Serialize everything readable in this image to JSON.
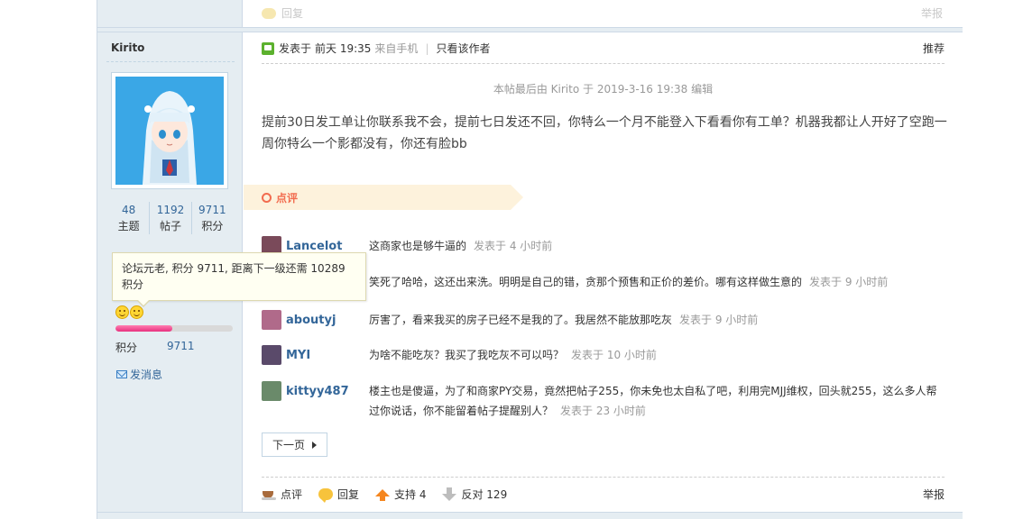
{
  "prev_post": {
    "reply_label": "回复",
    "report_label": "举报"
  },
  "author": {
    "name": "Kirito",
    "stats": [
      {
        "num": "48",
        "label": "主题"
      },
      {
        "num": "1192",
        "label": "帖子"
      },
      {
        "num": "9711",
        "label": "积分"
      }
    ],
    "tooltip": "论坛元老, 积分 9711, 距离下一级还需 10289 积分",
    "progress": 0.485,
    "score_label": "积分",
    "score_value": "9711",
    "send_message": "发消息"
  },
  "post": {
    "posted_prefix": "发表于",
    "posted_time": "前天 19:35",
    "from_mobile": "来自手机",
    "separator": "|",
    "only_author": "只看该作者",
    "recommend": "推荐",
    "edit_note": "本帖最后由 Kirito 于 2019-3-16 19:38 编辑",
    "content": "提前30日发工单让你联系我不会，提前七日发还不回，你特么一个月不能登入下看看你有工单？机器我都让人开好了空跑一周你特么一个影都没有，你还有脸bb"
  },
  "review": {
    "label": "点评",
    "comments": [
      {
        "user": "Lancelot",
        "text": "这商家也是够牛逼的",
        "time": "发表于 4 小时前",
        "avatar_color": "#7a4a5a"
      },
      {
        "user": "",
        "text": "笑死了哈哈，这还出来洗。明明是自己的错，贪那个预售和正价的差价。哪有这样做生意的",
        "time": "发表于 9 小时前",
        "avatar_color": "#888888"
      },
      {
        "user": "aboutyj",
        "text": "厉害了，看来我买的房子已经不是我的了。我居然不能放那吃灰",
        "time": "发表于 9 小时前",
        "avatar_color": "#b06a8a"
      },
      {
        "user": "MYI",
        "text": "为啥不能吃灰？我买了我吃灰不可以吗？",
        "time": "发表于 10 小时前",
        "avatar_color": "#5a4a6a"
      },
      {
        "user": "kittyy487",
        "text": "楼主也是傻逼，为了和商家PY交易，竟然把帖子255，你未免也太自私了吧，利用完MJJ维权，回头就255，这么多人帮过你说话，你不能留着帖子提醒别人？",
        "time": "发表于 23 小时前",
        "avatar_color": "#6a8a6a"
      }
    ],
    "next_page": "下一页"
  },
  "actions": {
    "review": "点评",
    "reply": "回复",
    "support": "支持 4",
    "oppose": "反对 129",
    "report": "举报"
  }
}
